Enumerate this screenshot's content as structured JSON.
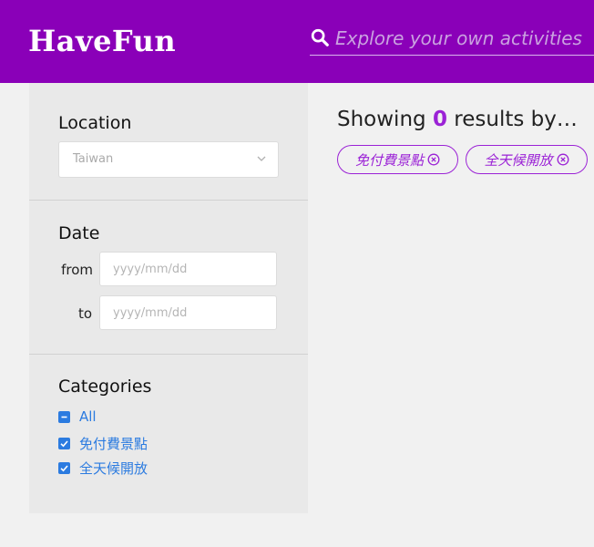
{
  "header": {
    "logo": "HaveFun",
    "search_placeholder": "Explore your own activities"
  },
  "sidebar": {
    "location": {
      "title": "Location",
      "value": "Taiwan"
    },
    "date": {
      "title": "Date",
      "from_label": "from",
      "to_label": "to",
      "from_placeholder": "yyyy/mm/dd",
      "to_placeholder": "yyyy/mm/dd"
    },
    "categories": {
      "title": "Categories",
      "items": [
        {
          "label": "All",
          "state": "indeterminate"
        },
        {
          "label": "免付費景點",
          "state": "checked"
        },
        {
          "label": "全天候開放",
          "state": "checked"
        }
      ]
    }
  },
  "results": {
    "prefix": "Showing",
    "count": "0",
    "suffix": "results by…",
    "tags": [
      "免付費景點",
      "全天候開放"
    ]
  },
  "colors": {
    "header": "#8a00b8",
    "accent": "#9b22d6",
    "link": "#2b7be0"
  }
}
